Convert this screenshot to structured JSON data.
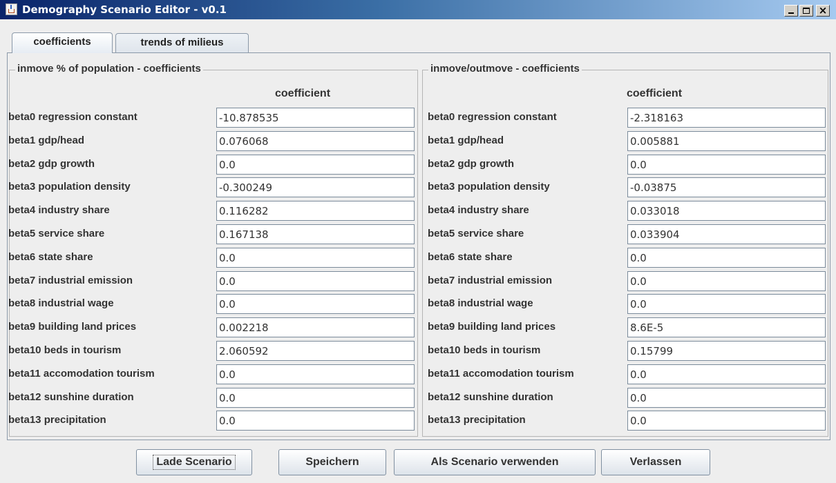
{
  "window": {
    "title": "Demography Scenario Editor - v0.1",
    "app_icon": "java-cup-icon",
    "controls": {
      "minimize": "_",
      "maximize": "□",
      "close": "×"
    }
  },
  "tabs": [
    {
      "label": "coefficients",
      "active": true
    },
    {
      "label": "trends of milieus",
      "active": false
    }
  ],
  "panels": [
    {
      "title": "inmove % of population - coefficients",
      "column_header": "coefficient",
      "rows": [
        {
          "label": "beta0 regression constant",
          "value": "-10.878535"
        },
        {
          "label": "beta1 gdp/head",
          "value": "0.076068"
        },
        {
          "label": "beta2 gdp growth",
          "value": "0.0"
        },
        {
          "label": "beta3 population density",
          "value": "-0.300249"
        },
        {
          "label": "beta4 industry share",
          "value": "0.116282"
        },
        {
          "label": "beta5 service share",
          "value": "0.167138"
        },
        {
          "label": "beta6 state share",
          "value": "0.0"
        },
        {
          "label": "beta7 industrial emission",
          "value": "0.0"
        },
        {
          "label": "beta8 industrial wage",
          "value": "0.0"
        },
        {
          "label": "beta9 building land prices",
          "value": "0.002218"
        },
        {
          "label": "beta10 beds in tourism",
          "value": "2.060592"
        },
        {
          "label": "beta11 accomodation tourism",
          "value": "0.0"
        },
        {
          "label": "beta12 sunshine duration",
          "value": "0.0"
        },
        {
          "label": "beta13 precipitation",
          "value": "0.0"
        }
      ]
    },
    {
      "title": "inmove/outmove - coefficients",
      "column_header": "coefficient",
      "rows": [
        {
          "label": "beta0 regression constant",
          "value": "-2.318163"
        },
        {
          "label": "beta1 gdp/head",
          "value": "0.005881"
        },
        {
          "label": "beta2 gdp growth",
          "value": "0.0"
        },
        {
          "label": "beta3 population density",
          "value": "-0.03875"
        },
        {
          "label": "beta4 industry share",
          "value": "0.033018"
        },
        {
          "label": "beta5 service share",
          "value": "0.033904"
        },
        {
          "label": "beta6 state share",
          "value": "0.0"
        },
        {
          "label": "beta7 industrial emission",
          "value": "0.0"
        },
        {
          "label": "beta8 industrial wage",
          "value": "0.0"
        },
        {
          "label": "beta9 building land prices",
          "value": "8.6E-5"
        },
        {
          "label": "beta10 beds in tourism",
          "value": "0.15799"
        },
        {
          "label": "beta11 accomodation tourism",
          "value": "0.0"
        },
        {
          "label": "beta12 sunshine duration",
          "value": "0.0"
        },
        {
          "label": "beta13 precipitation",
          "value": "0.0"
        }
      ]
    }
  ],
  "buttons": [
    {
      "label": "Lade Scenario",
      "focused": true
    },
    {
      "label": "Speichern",
      "focused": false
    },
    {
      "label": "Als Scenario verwenden",
      "focused": false
    },
    {
      "label": "Verlassen",
      "focused": false
    }
  ]
}
